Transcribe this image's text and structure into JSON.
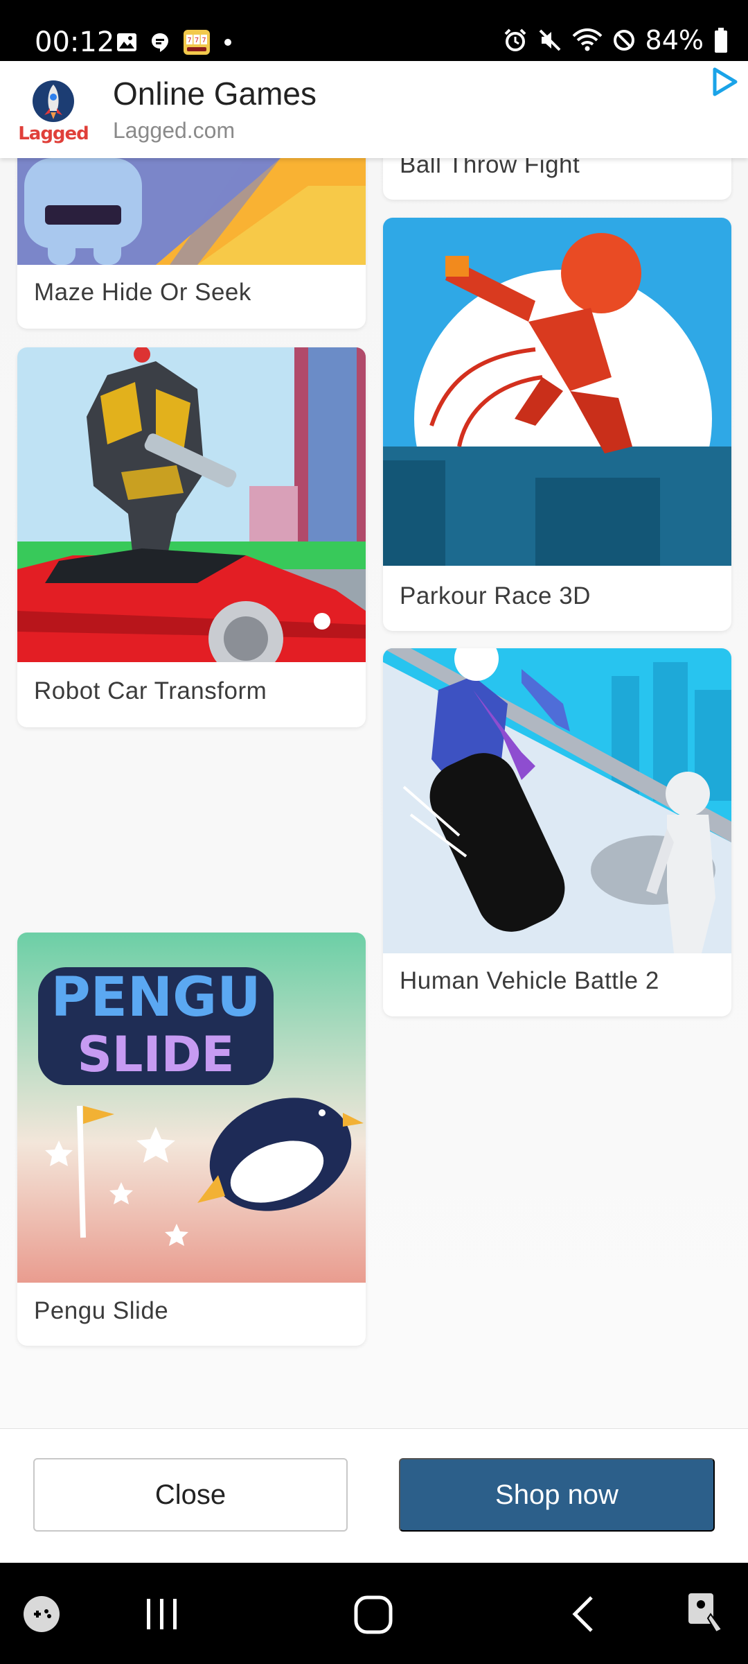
{
  "status_bar": {
    "time": "00:12",
    "battery_percent": "84%",
    "left_icons": [
      "gallery-icon",
      "messenger-icon",
      "slots-app-icon",
      "dot-icon"
    ],
    "right_icons": [
      "alarm-icon",
      "mute-icon",
      "wifi-icon",
      "no-disturb-icon",
      "battery-icon"
    ]
  },
  "ad_header": {
    "logo_text": "Lagged",
    "title": "Online Games",
    "subtitle": "Lagged.com"
  },
  "games": {
    "left": [
      {
        "title": "Maze Hide Or Seek"
      },
      {
        "title": "Robot Car Transform"
      },
      {
        "title": "Pengu Slide",
        "thumb_text_1": "PENGU",
        "thumb_text_2": "SLIDE"
      }
    ],
    "right": [
      {
        "title": "Ball Throw Fight"
      },
      {
        "title": "Parkour Race 3D"
      },
      {
        "title": "Human Vehicle Battle 2"
      }
    ]
  },
  "actions": {
    "close_label": "Close",
    "shop_label": "Shop now"
  },
  "colors": {
    "shop_button": "#2c5f8a",
    "ad_choices": "#1aa3e8"
  },
  "nav_bar": {
    "icons": [
      "game-launcher-icon",
      "recent-apps-icon",
      "home-icon",
      "back-icon",
      "accessibility-icon"
    ]
  }
}
